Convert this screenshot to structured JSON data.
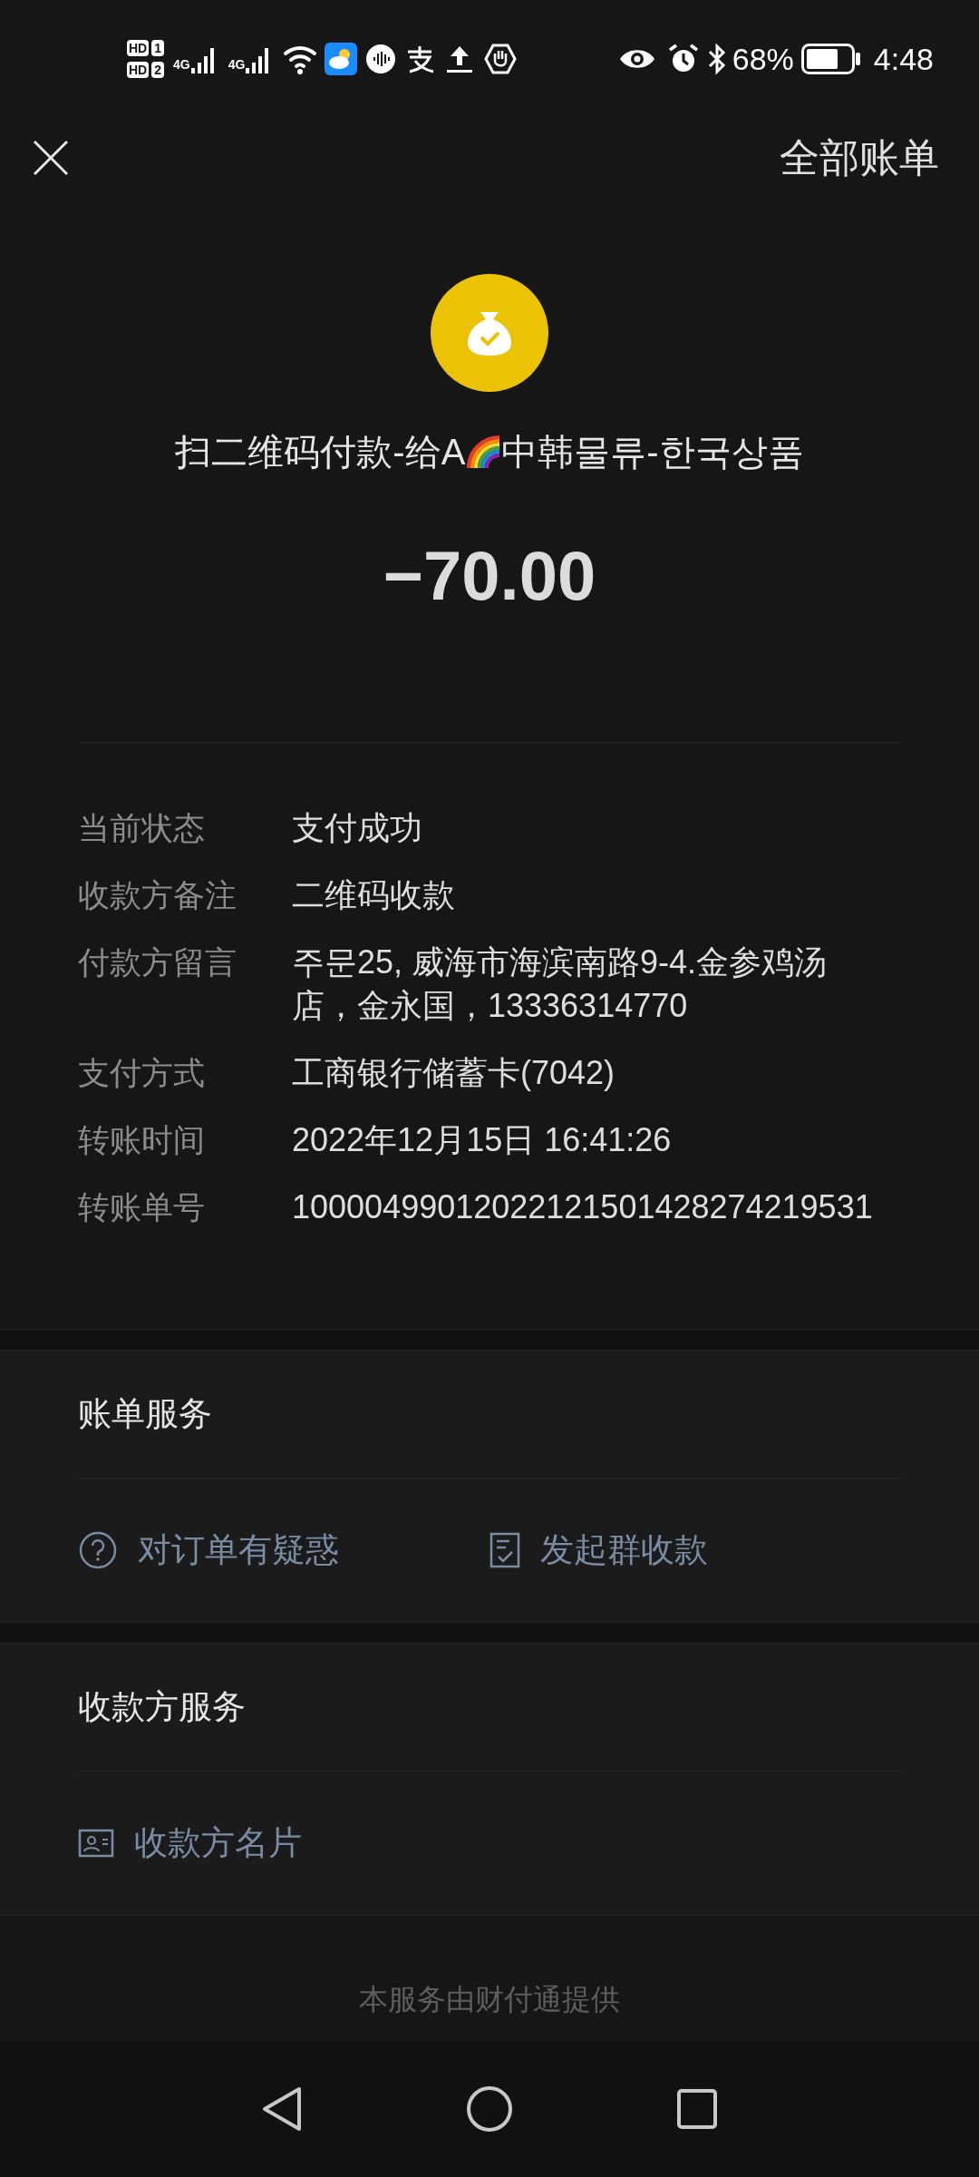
{
  "status_bar": {
    "sim_labels": [
      "HD",
      "HD"
    ],
    "sim_numbers": [
      "1",
      "2"
    ],
    "network": [
      "4G",
      "4G"
    ],
    "battery": "68%",
    "time": "4:48"
  },
  "header": {
    "action": "全部账单"
  },
  "payment": {
    "title_before": "扫二维码付款-给A",
    "title_after": "中韩물류-한국상품",
    "amount": "−70.00"
  },
  "details": [
    {
      "label": "当前状态",
      "value": "支付成功"
    },
    {
      "label": "收款方备注",
      "value": "二维码收款"
    },
    {
      "label": "付款方留言",
      "value": "주문25, 威海市海滨南路9-4.金参鸡汤店，金永国，13336314770"
    },
    {
      "label": "支付方式",
      "value": "工商银行储蓄卡(7042)"
    },
    {
      "label": "转账时间",
      "value": "2022年12月15日 16:41:26"
    },
    {
      "label": "转账单号",
      "value": "10000499012022121501428274219531"
    }
  ],
  "sections": [
    {
      "title": "账单服务",
      "actions": [
        {
          "kind": "question",
          "label": "对订单有疑惑"
        },
        {
          "kind": "receipt",
          "label": "发起群收款"
        }
      ]
    },
    {
      "title": "收款方服务",
      "actions": [
        {
          "kind": "card",
          "label": "收款方名片"
        }
      ]
    }
  ],
  "footer": "本服务由财付通提供"
}
